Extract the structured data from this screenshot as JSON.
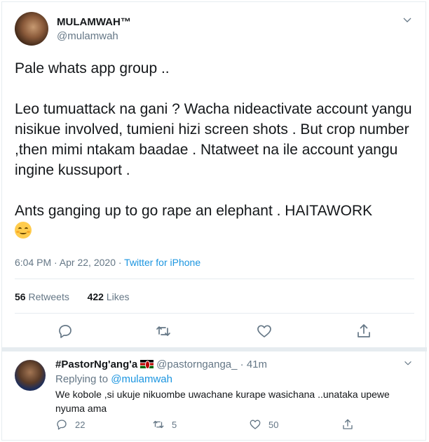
{
  "tweet": {
    "display_name": "MULAMWAH™",
    "handle": "@mulamwah",
    "avatar_icon": "profile-photo",
    "lines": [
      "Pale whats app group ..",
      "Leo tumuattack na gani ? Wacha nideactivate account yangu nisikue involved, tumieni hizi screen shots .  But crop number ,then mimi ntakam baadae . Ntatweet na ile account yangu ingine kussuport .",
      "Ants ganging up to go rape an elephant . HAITAWORK"
    ],
    "emoji": "relieved-face",
    "time": "6:04 PM · Apr 22, 2020 · ",
    "source": "Twitter for iPhone",
    "retweets_count": "56",
    "retweets_label": "Retweets",
    "likes_count": "422",
    "likes_label": "Likes"
  },
  "reply": {
    "display_name": "#PastorNg'ang'a",
    "handle": "@pastornganga_ · 41m",
    "replying_prefix": "Replying to ",
    "replying_to": "@mulamwah",
    "text": "We kobole ,si ukuje nikuombe uwachane kurape wasichana ..unataka upewe nyuma  ama",
    "replies": "22",
    "retweets": "5",
    "likes": "50"
  },
  "colors": {
    "accent": "#1b95e0",
    "muted": "#657786",
    "text": "#14171a",
    "border": "#e6ecf0"
  }
}
